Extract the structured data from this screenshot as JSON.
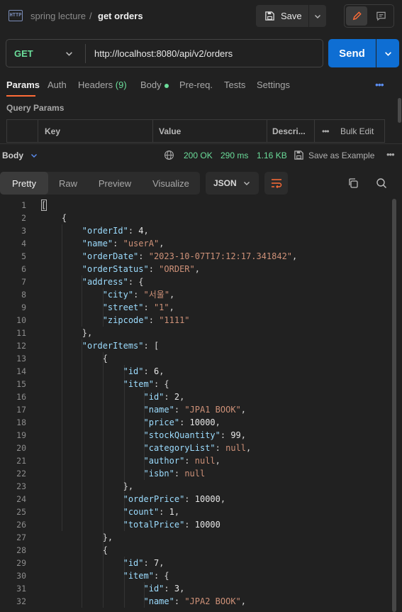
{
  "header": {
    "collection": "spring lecture",
    "separator": "/",
    "request_name": "get orders",
    "save_label": "Save",
    "app_icon": "http-icon"
  },
  "request": {
    "method": "GET",
    "url": "http://localhost:8080/api/v2/orders",
    "send_label": "Send"
  },
  "request_tabs": [
    {
      "label": "Params",
      "active": true
    },
    {
      "label": "Auth"
    },
    {
      "label": "Headers",
      "count": "(9)"
    },
    {
      "label": "Body",
      "dot": true
    },
    {
      "label": "Pre-req."
    },
    {
      "label": "Tests"
    },
    {
      "label": "Settings"
    }
  ],
  "query_params": {
    "title": "Query Params",
    "columns": [
      "Key",
      "Value",
      "Descri...",
      "Bulk Edit"
    ]
  },
  "response": {
    "body_label": "Body",
    "status": "200 OK",
    "time": "290 ms",
    "size": "1.16 KB",
    "save_example": "Save as Example",
    "view_tabs": [
      "Pretty",
      "Raw",
      "Preview",
      "Visualize"
    ],
    "active_view": "Pretty",
    "format": "JSON"
  },
  "code": {
    "line_numbers": [
      "1",
      "2",
      "3",
      "4",
      "5",
      "6",
      "7",
      "8",
      "9",
      "10",
      "11",
      "12",
      "13",
      "14",
      "15",
      "16",
      "17",
      "18",
      "19",
      "20",
      "21",
      "22",
      "23",
      "24",
      "25",
      "26",
      "27",
      "28",
      "29",
      "30",
      "31",
      "32"
    ],
    "lines": [
      [
        {
          "t": "p",
          "v": "["
        }
      ],
      [
        {
          "t": "p",
          "v": "    {"
        }
      ],
      [
        {
          "t": "p",
          "v": "        "
        },
        {
          "t": "k",
          "v": "\"orderId\""
        },
        {
          "t": "p",
          "v": ": "
        },
        {
          "t": "n",
          "v": "4"
        },
        {
          "t": "p",
          "v": ","
        }
      ],
      [
        {
          "t": "p",
          "v": "        "
        },
        {
          "t": "k",
          "v": "\"name\""
        },
        {
          "t": "p",
          "v": ": "
        },
        {
          "t": "s",
          "v": "\"userA\""
        },
        {
          "t": "p",
          "v": ","
        }
      ],
      [
        {
          "t": "p",
          "v": "        "
        },
        {
          "t": "k",
          "v": "\"orderDate\""
        },
        {
          "t": "p",
          "v": ": "
        },
        {
          "t": "s",
          "v": "\"2023-10-07T17:12:17.341842\""
        },
        {
          "t": "p",
          "v": ","
        }
      ],
      [
        {
          "t": "p",
          "v": "        "
        },
        {
          "t": "k",
          "v": "\"orderStatus\""
        },
        {
          "t": "p",
          "v": ": "
        },
        {
          "t": "s",
          "v": "\"ORDER\""
        },
        {
          "t": "p",
          "v": ","
        }
      ],
      [
        {
          "t": "p",
          "v": "        "
        },
        {
          "t": "k",
          "v": "\"address\""
        },
        {
          "t": "p",
          "v": ": {"
        }
      ],
      [
        {
          "t": "p",
          "v": "            "
        },
        {
          "t": "k",
          "v": "\"city\""
        },
        {
          "t": "p",
          "v": ": "
        },
        {
          "t": "s",
          "v": "\"서울\""
        },
        {
          "t": "p",
          "v": ","
        }
      ],
      [
        {
          "t": "p",
          "v": "            "
        },
        {
          "t": "k",
          "v": "\"street\""
        },
        {
          "t": "p",
          "v": ": "
        },
        {
          "t": "s",
          "v": "\"1\""
        },
        {
          "t": "p",
          "v": ","
        }
      ],
      [
        {
          "t": "p",
          "v": "            "
        },
        {
          "t": "k",
          "v": "\"zipcode\""
        },
        {
          "t": "p",
          "v": ": "
        },
        {
          "t": "s",
          "v": "\"1111\""
        }
      ],
      [
        {
          "t": "p",
          "v": "        },"
        }
      ],
      [
        {
          "t": "p",
          "v": "        "
        },
        {
          "t": "k",
          "v": "\"orderItems\""
        },
        {
          "t": "p",
          "v": ": ["
        }
      ],
      [
        {
          "t": "p",
          "v": "            {"
        }
      ],
      [
        {
          "t": "p",
          "v": "                "
        },
        {
          "t": "k",
          "v": "\"id\""
        },
        {
          "t": "p",
          "v": ": "
        },
        {
          "t": "n",
          "v": "6"
        },
        {
          "t": "p",
          "v": ","
        }
      ],
      [
        {
          "t": "p",
          "v": "                "
        },
        {
          "t": "k",
          "v": "\"item\""
        },
        {
          "t": "p",
          "v": ": {"
        }
      ],
      [
        {
          "t": "p",
          "v": "                    "
        },
        {
          "t": "k",
          "v": "\"id\""
        },
        {
          "t": "p",
          "v": ": "
        },
        {
          "t": "n",
          "v": "2"
        },
        {
          "t": "p",
          "v": ","
        }
      ],
      [
        {
          "t": "p",
          "v": "                    "
        },
        {
          "t": "k",
          "v": "\"name\""
        },
        {
          "t": "p",
          "v": ": "
        },
        {
          "t": "s",
          "v": "\"JPA1 BOOK\""
        },
        {
          "t": "p",
          "v": ","
        }
      ],
      [
        {
          "t": "p",
          "v": "                    "
        },
        {
          "t": "k",
          "v": "\"price\""
        },
        {
          "t": "p",
          "v": ": "
        },
        {
          "t": "n",
          "v": "10000"
        },
        {
          "t": "p",
          "v": ","
        }
      ],
      [
        {
          "t": "p",
          "v": "                    "
        },
        {
          "t": "k",
          "v": "\"stockQuantity\""
        },
        {
          "t": "p",
          "v": ": "
        },
        {
          "t": "n",
          "v": "99"
        },
        {
          "t": "p",
          "v": ","
        }
      ],
      [
        {
          "t": "p",
          "v": "                    "
        },
        {
          "t": "k",
          "v": "\"categoryList\""
        },
        {
          "t": "p",
          "v": ": "
        },
        {
          "t": "nl",
          "v": "null"
        },
        {
          "t": "p",
          "v": ","
        }
      ],
      [
        {
          "t": "p",
          "v": "                    "
        },
        {
          "t": "k",
          "v": "\"author\""
        },
        {
          "t": "p",
          "v": ": "
        },
        {
          "t": "nl",
          "v": "null"
        },
        {
          "t": "p",
          "v": ","
        }
      ],
      [
        {
          "t": "p",
          "v": "                    "
        },
        {
          "t": "k",
          "v": "\"isbn\""
        },
        {
          "t": "p",
          "v": ": "
        },
        {
          "t": "nl",
          "v": "null"
        }
      ],
      [
        {
          "t": "p",
          "v": "                },"
        }
      ],
      [
        {
          "t": "p",
          "v": "                "
        },
        {
          "t": "k",
          "v": "\"orderPrice\""
        },
        {
          "t": "p",
          "v": ": "
        },
        {
          "t": "n",
          "v": "10000"
        },
        {
          "t": "p",
          "v": ","
        }
      ],
      [
        {
          "t": "p",
          "v": "                "
        },
        {
          "t": "k",
          "v": "\"count\""
        },
        {
          "t": "p",
          "v": ": "
        },
        {
          "t": "n",
          "v": "1"
        },
        {
          "t": "p",
          "v": ","
        }
      ],
      [
        {
          "t": "p",
          "v": "                "
        },
        {
          "t": "k",
          "v": "\"totalPrice\""
        },
        {
          "t": "p",
          "v": ": "
        },
        {
          "t": "n",
          "v": "10000"
        }
      ],
      [
        {
          "t": "p",
          "v": "            },"
        }
      ],
      [
        {
          "t": "p",
          "v": "            {"
        }
      ],
      [
        {
          "t": "p",
          "v": "                "
        },
        {
          "t": "k",
          "v": "\"id\""
        },
        {
          "t": "p",
          "v": ": "
        },
        {
          "t": "n",
          "v": "7"
        },
        {
          "t": "p",
          "v": ","
        }
      ],
      [
        {
          "t": "p",
          "v": "                "
        },
        {
          "t": "k",
          "v": "\"item\""
        },
        {
          "t": "p",
          "v": ": {"
        }
      ],
      [
        {
          "t": "p",
          "v": "                    "
        },
        {
          "t": "k",
          "v": "\"id\""
        },
        {
          "t": "p",
          "v": ": "
        },
        {
          "t": "n",
          "v": "3"
        },
        {
          "t": "p",
          "v": ","
        }
      ],
      [
        {
          "t": "p",
          "v": "                    "
        },
        {
          "t": "k",
          "v": "\"name\""
        },
        {
          "t": "p",
          "v": ": "
        },
        {
          "t": "s",
          "v": "\"JPA2 BOOK\""
        },
        {
          "t": "p",
          "v": ","
        }
      ]
    ]
  },
  "colors": {
    "accent_orange": "#ff6c37",
    "send_blue": "#0e6ed3",
    "method_green": "#6bdd9a",
    "key_blue": "#9cdcfe",
    "string_orange": "#ce9178"
  }
}
